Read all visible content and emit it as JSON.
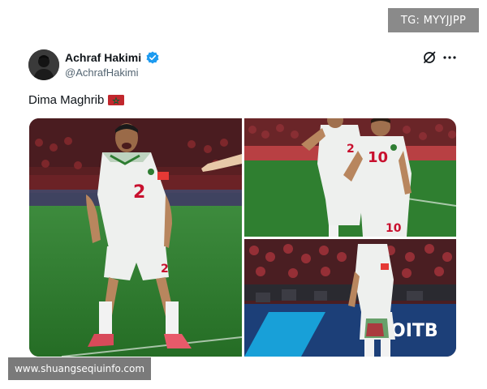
{
  "overlay": {
    "telegram_label": "TG: MYYJJPP"
  },
  "tweet": {
    "display_name": "Achraf Hakimi",
    "handle": "@AchrafHakimi",
    "text": "Dima Maghrib",
    "text_emoji": "morocco-flag-icon"
  },
  "media": {
    "main_jersey_number": "2",
    "top_right_numbers": [
      "2",
      "10",
      "10"
    ],
    "bottom_right_sign": "OITB"
  },
  "footer": {
    "watermark_url": "www.shuangseqiuinfo.com"
  },
  "colors": {
    "verified": "#1d9bf0",
    "handle": "#536471",
    "jersey": "#eef0ee",
    "jersey_number": "#c8102e",
    "pitch": "#2e7d32",
    "morocco_red": "#c1272d",
    "morocco_green": "#006233"
  }
}
